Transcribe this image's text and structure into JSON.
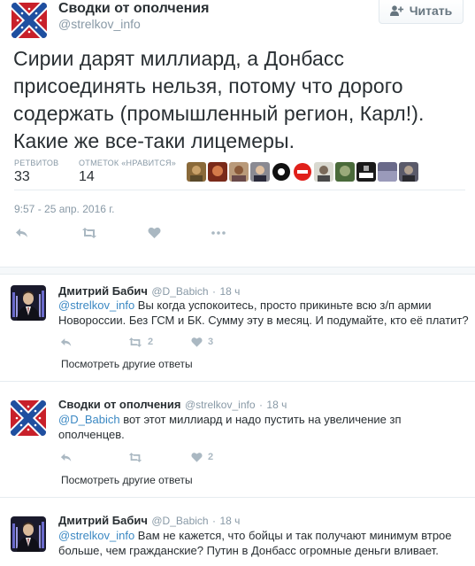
{
  "tweet": {
    "author_name": "Сводки от ополчения",
    "author_handle": "@strelkov_info",
    "follow_label": "Читать",
    "text": "Сирии дарят миллиард, а Донбасс присоединять нельзя, потому что дорого содержать (промышленный регион, Карл!). Какие же все-таки лицемеры.",
    "retweets_label": "РЕТВИТОВ",
    "retweets_count": "33",
    "likes_label": "ОТМЕТОК «НРАВИТСЯ»",
    "likes_count": "14",
    "timestamp": "9:57 - 25 апр. 2016 г."
  },
  "replies": [
    {
      "author_name": "Дмитрий Бабич",
      "author_handle": "@D_Babich",
      "sep": "·",
      "age": "18 ч",
      "mention": "@strelkov_info",
      "text": " Вы когда успокоитесь, просто прикиньте всю з/п армии Новороссии. Без ГСМ и БК. Сумму эту в месяц. И подумайте, кто её платит?",
      "retweets": "2",
      "likes": "3",
      "more_label": "Посмотреть другие ответы"
    },
    {
      "author_name": "Сводки от ополчения",
      "author_handle": "@strelkov_info",
      "sep": "·",
      "age": "18 ч",
      "mention": "@D_Babich",
      "text": " вот этот миллиард и надо пустить на увеличение зп ополченцев.",
      "retweets": "",
      "likes": "2",
      "more_label": "Посмотреть другие ответы"
    },
    {
      "author_name": "Дмитрий Бабич",
      "author_handle": "@D_Babich",
      "sep": "·",
      "age": "18 ч",
      "mention": "@strelkov_info",
      "text": " Вам не кажется, что бойцы и так получают минимум втрое больше, чем гражданские? Путин в Донбасс огромные деньги вливает."
    }
  ],
  "colors": {
    "text": "#292f33",
    "muted": "#8899a6",
    "icon": "#aab8c2",
    "mention": "#3b88c3",
    "divider": "#e6ecf0",
    "flag_red": "#c8202a",
    "flag_blue": "#1f4fa0"
  },
  "icons": [
    "follow-user-icon",
    "reply-icon",
    "retweet-icon",
    "like-icon",
    "more-icon"
  ]
}
